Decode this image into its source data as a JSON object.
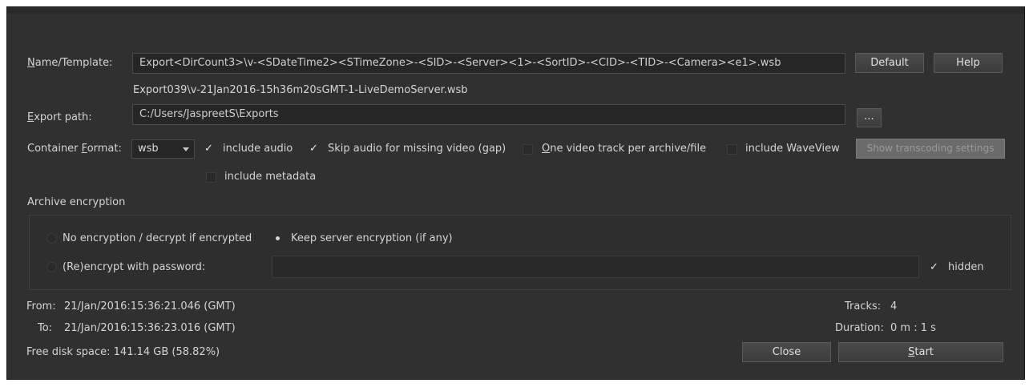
{
  "name_template": {
    "label_prefix": "N",
    "label_rest": "ame/Template:",
    "value": "Export<DirCount3>\\v-<SDateTime2><STimeZone>-<SID>-<Server><1>-<SortID>-<CID>-<TID>-<Camera><e1>.wsb",
    "preview": "Export039\\v-21Jan2016-15h36m20sGMT-1-LiveDemoServer.wsb",
    "default_button": "Default",
    "help_button": "Help"
  },
  "export_path": {
    "label_prefix": "E",
    "label_rest": "xport path:",
    "value": "C:/Users/JaspreetS\\Exports",
    "browse_button": "..."
  },
  "container": {
    "label_start": "Container ",
    "label_underlined": "F",
    "label_end": "ormat:",
    "format_value": "wsb",
    "include_audio": "include audio",
    "skip_audio": "Skip audio for missing video (gap)",
    "one_track_prefix": "O",
    "one_track_rest": "ne video track per archive/file",
    "include_waveview": "include WaveView",
    "show_transcoding": "Show transcoding settings",
    "include_metadata": "include metadata"
  },
  "encryption": {
    "title": "Archive encryption",
    "no_encryption": "No encryption / decrypt if encrypted",
    "keep_server": "Keep server encryption (if any)",
    "reencrypt": "(Re)encrypt with password:",
    "hidden": "hidden"
  },
  "info": {
    "from_label": "From:",
    "from_value": "21/Jan/2016:15:36:21.046 (GMT)",
    "to_label": "To:",
    "to_value": "21/Jan/2016:15:36:23.016 (GMT)",
    "tracks_label": "Tracks:",
    "tracks_value": "4",
    "duration_label": "Duration:",
    "duration_value": "0 m : 1 s",
    "free_disk": "Free disk space:  141.14 GB (58.82%)"
  },
  "actions": {
    "close": "Close",
    "start_prefix": "S",
    "start_rest": "tart"
  },
  "checkmark_glyph": "✓"
}
